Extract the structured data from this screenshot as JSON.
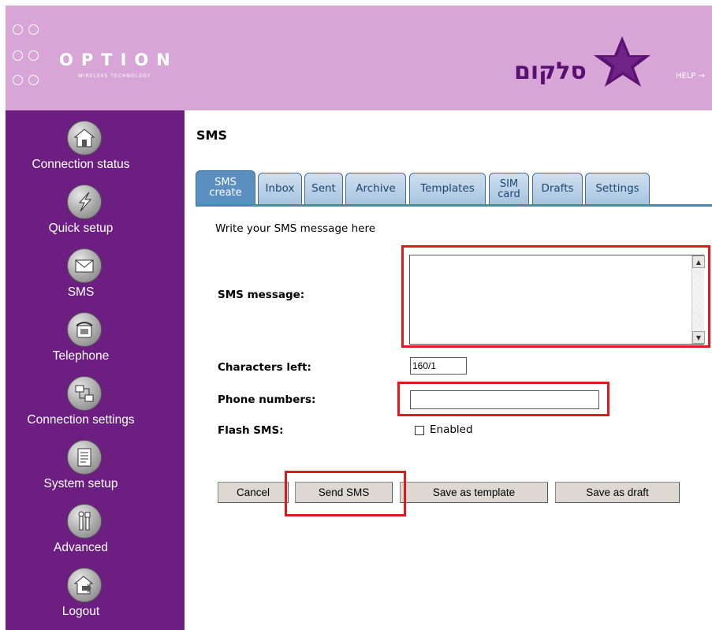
{
  "header": {
    "logo_word": "OPTION",
    "logo_sub": "WIRELESS TECHNOLOGY",
    "brand_word": "סלקום",
    "help_label": "HELP →"
  },
  "sidebar": {
    "items": [
      {
        "label": "Connection status",
        "icon": "home-icon"
      },
      {
        "label": "Quick setup",
        "icon": "lightning-icon"
      },
      {
        "label": "SMS",
        "icon": "envelope-icon"
      },
      {
        "label": "Telephone",
        "icon": "telephone-icon"
      },
      {
        "label": "Connection settings",
        "icon": "network-icon"
      },
      {
        "label": "System setup",
        "icon": "document-icon"
      },
      {
        "label": "Advanced",
        "icon": "tools-icon"
      },
      {
        "label": "Logout",
        "icon": "logout-icon"
      }
    ]
  },
  "main": {
    "title": "SMS",
    "tabs": [
      {
        "label_line1": "SMS",
        "label_line2": "create",
        "active": true
      },
      {
        "label": "Inbox"
      },
      {
        "label": "Sent"
      },
      {
        "label": "Archive"
      },
      {
        "label": "Templates"
      },
      {
        "label_line1": "SIM",
        "label_line2": "card"
      },
      {
        "label": "Drafts"
      },
      {
        "label": "Settings"
      }
    ],
    "intro": "Write your SMS message here",
    "form": {
      "sms_message_label": "SMS message:",
      "sms_message_value": "",
      "characters_left_label": "Characters left:",
      "characters_left_value": "160/1",
      "phone_numbers_label": "Phone numbers:",
      "phone_numbers_value": "",
      "flash_sms_label": "Flash SMS:",
      "flash_enabled_label": "Enabled",
      "flash_enabled_checked": false
    },
    "buttons": {
      "cancel": "Cancel",
      "send": "Send SMS",
      "save_template": "Save as template",
      "save_draft": "Save as draft"
    }
  },
  "colors": {
    "header_bg": "#d7a5d6",
    "sidebar_bg": "#6c1f80",
    "tab_active": "#5b8fc0",
    "highlight": "#e0191f"
  }
}
